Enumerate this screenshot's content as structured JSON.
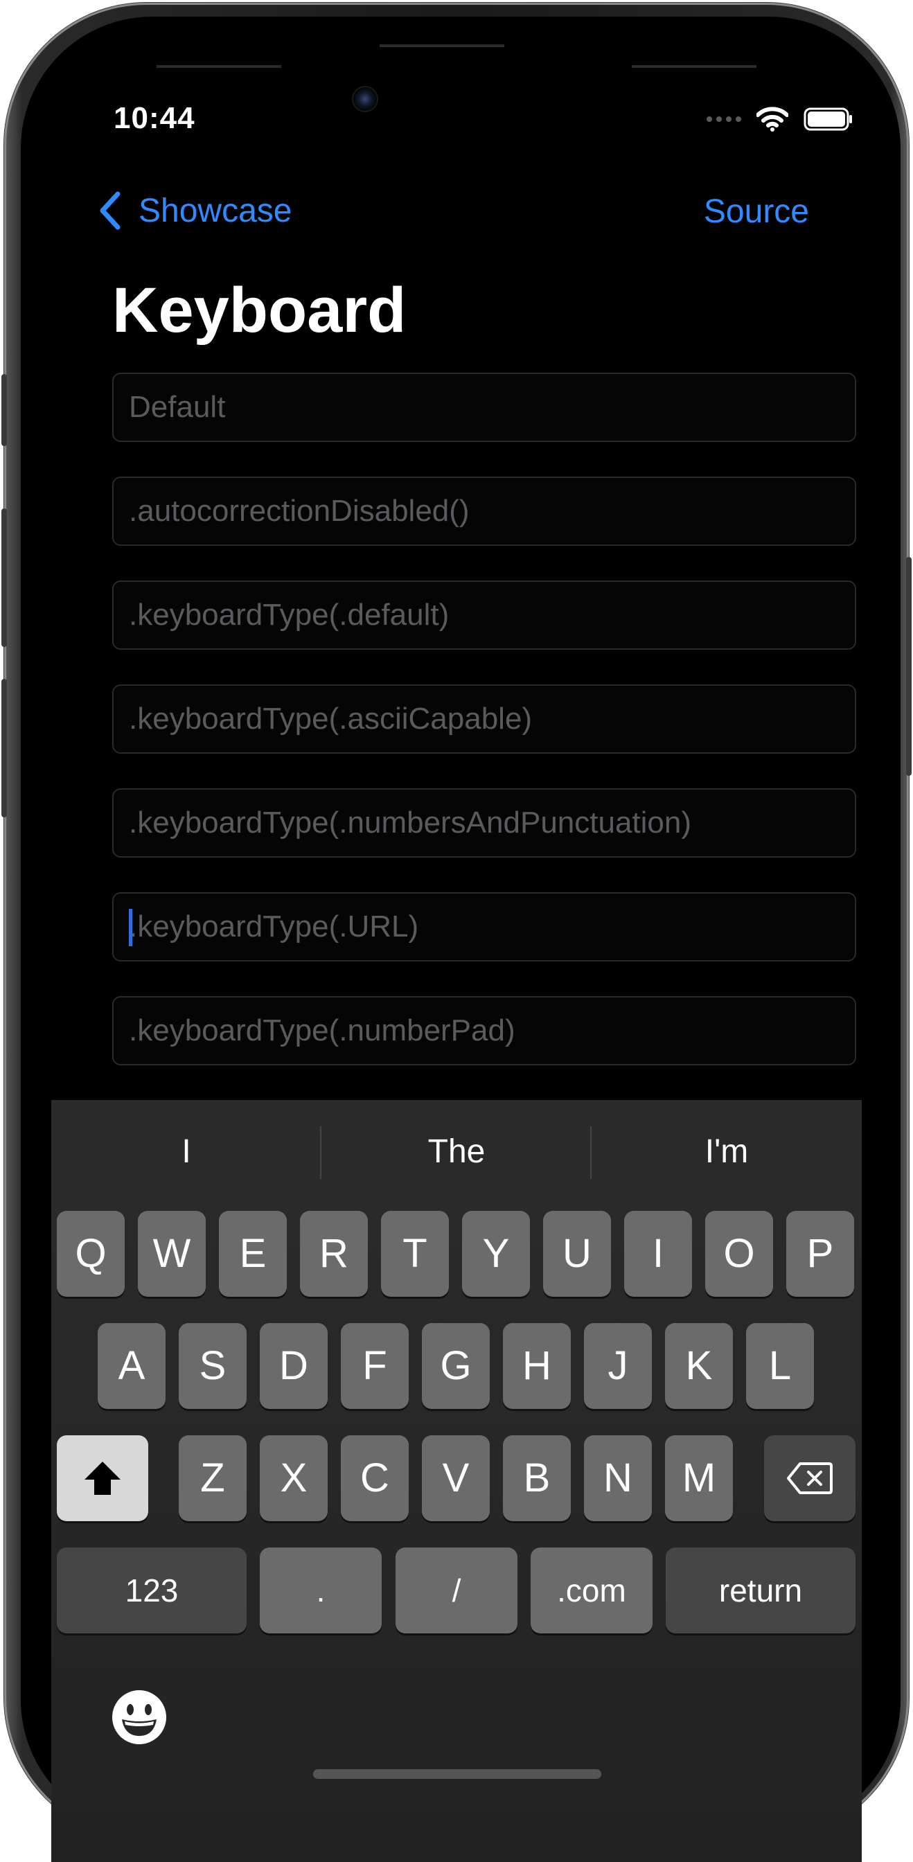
{
  "status_bar": {
    "time": "10:44"
  },
  "nav": {
    "back_label": "Showcase",
    "right_label": "Source"
  },
  "page": {
    "title": "Keyboard"
  },
  "fields": [
    {
      "placeholder": "Default",
      "focused": false
    },
    {
      "placeholder": ".autocorrectionDisabled()",
      "focused": false
    },
    {
      "placeholder": ".keyboardType(.default)",
      "focused": false
    },
    {
      "placeholder": ".keyboardType(.asciiCapable)",
      "focused": false
    },
    {
      "placeholder": ".keyboardType(.numbersAndPunctuation)",
      "focused": false
    },
    {
      "placeholder": ".keyboardType(.URL)",
      "focused": true
    },
    {
      "placeholder": ".keyboardType(.numberPad)",
      "focused": false
    }
  ],
  "keyboard": {
    "suggestions": [
      "I",
      "The",
      "I'm"
    ],
    "row1": [
      "Q",
      "W",
      "E",
      "R",
      "T",
      "Y",
      "U",
      "I",
      "O",
      "P"
    ],
    "row2": [
      "A",
      "S",
      "D",
      "F",
      "G",
      "H",
      "J",
      "K",
      "L"
    ],
    "row3": [
      "Z",
      "X",
      "C",
      "V",
      "B",
      "N",
      "M"
    ],
    "bottom": {
      "numbers": "123",
      "dot": ".",
      "slash": "/",
      "dotcom": ".com",
      "return": "return"
    },
    "icons": {
      "shift": "shift-icon",
      "delete": "delete-icon",
      "emoji": "emoji-icon"
    }
  },
  "colors": {
    "accent": "#2f8bff",
    "background": "#000000",
    "key": "#6b6b6b",
    "key_dark": "#464646"
  }
}
